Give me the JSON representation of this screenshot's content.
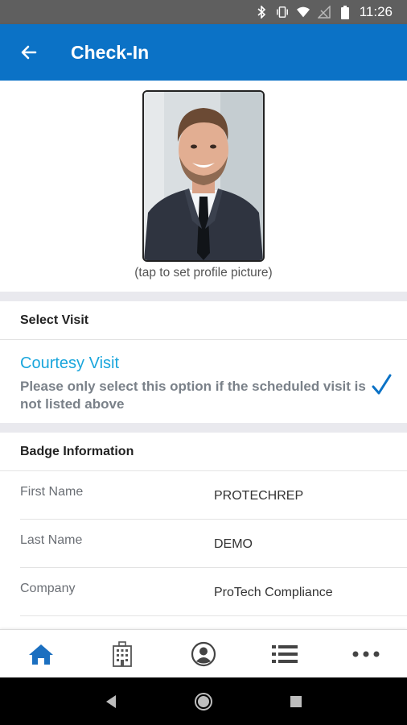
{
  "status_bar": {
    "time": "11:26",
    "icons": [
      "bluetooth-icon",
      "vibrate-icon",
      "wifi-icon",
      "no-signal-icon",
      "battery-icon"
    ]
  },
  "app_bar": {
    "title": "Check-In",
    "back_icon": "arrow-left-icon",
    "color": "#0b72c6"
  },
  "profile": {
    "caption": "(tap to set profile picture)"
  },
  "select_visit": {
    "header": "Select Visit",
    "option": {
      "title": "Courtesy Visit",
      "description": "Please only select this option if the scheduled visit is not listed above",
      "selected": true,
      "check_icon": "checkmark-icon",
      "accent": "#1aa6dc"
    }
  },
  "badge": {
    "header": "Badge Information",
    "fields": [
      {
        "label": "First Name",
        "value": "PROTECHREP"
      },
      {
        "label": "Last Name",
        "value": "DEMO"
      },
      {
        "label": "Company",
        "value": "ProTech Compliance"
      }
    ]
  },
  "bottom_nav": {
    "items": [
      {
        "icon": "home-icon",
        "active": true
      },
      {
        "icon": "building-icon",
        "active": false
      },
      {
        "icon": "profile-icon",
        "active": false
      },
      {
        "icon": "list-icon",
        "active": false
      },
      {
        "icon": "more-icon",
        "active": false
      }
    ]
  },
  "system_nav": {
    "icons": [
      "back-triangle-icon",
      "home-circle-icon",
      "recents-square-icon"
    ]
  }
}
